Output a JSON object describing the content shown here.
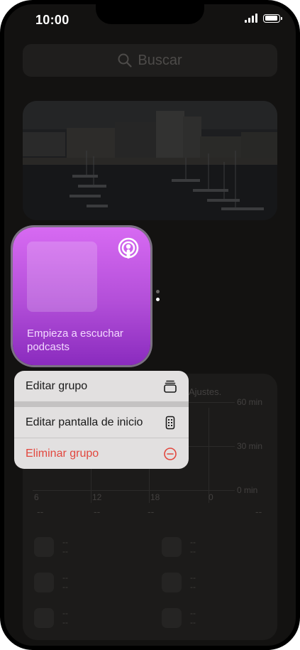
{
  "status": {
    "time": "10:00"
  },
  "search": {
    "placeholder": "Buscar"
  },
  "widget": {
    "text": "Empieza a escuchar podcasts",
    "icon": "podcasts-icon",
    "color": "#b24ed8"
  },
  "screen_time": {
    "hint": "Ajustes.",
    "y_labels": [
      "60 min",
      "30 min",
      "0 min"
    ],
    "x_labels": [
      "6",
      "12",
      "18",
      "0"
    ],
    "summary": [
      "--",
      "--",
      "--",
      "--"
    ],
    "apps": [
      {
        "name": "--",
        "time": "--"
      },
      {
        "name": "--",
        "time": "--"
      },
      {
        "name": "--",
        "time": "--"
      },
      {
        "name": "--",
        "time": "--"
      },
      {
        "name": "--",
        "time": "--"
      },
      {
        "name": "--",
        "time": "--"
      }
    ]
  },
  "context_menu": {
    "items": [
      {
        "label": "Editar grupo",
        "icon": "stack-icon"
      },
      {
        "label": "Editar pantalla de inicio",
        "icon": "phone-icon"
      },
      {
        "label": "Eliminar grupo",
        "icon": "minus-circle-icon",
        "destructive": true
      }
    ],
    "destructive_color": "#e2473e"
  },
  "page_indicator": {
    "pages": 2,
    "current": 2
  }
}
